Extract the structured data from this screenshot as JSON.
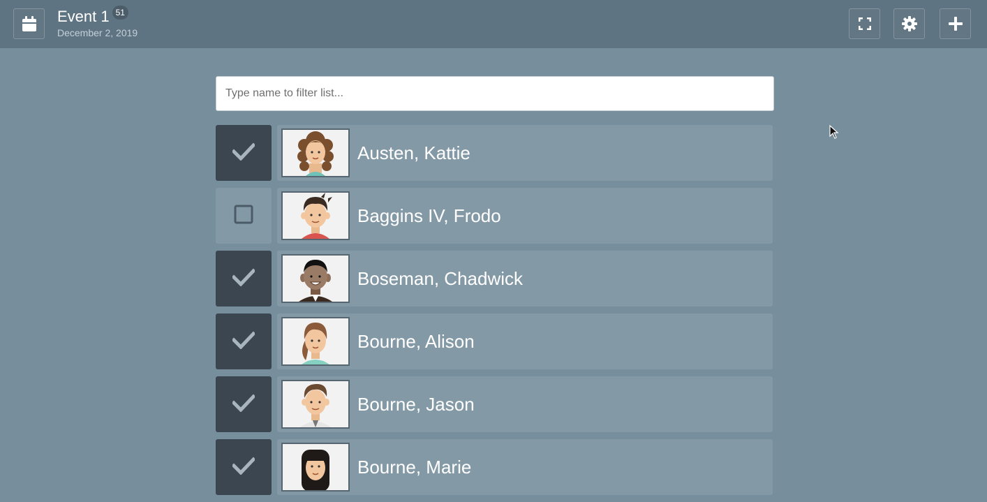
{
  "header": {
    "title": "Event 1",
    "count_badge": "51",
    "date": "December 2, 2019",
    "buttons": {
      "calendar_icon": "calendar-icon",
      "fullscreen_icon": "fullscreen-icon",
      "settings_icon": "gear-icon",
      "add_icon": "plus-icon"
    }
  },
  "filter": {
    "placeholder": "Type name to filter list...",
    "value": ""
  },
  "attendees": [
    {
      "name": "Austen, Kattie",
      "checked": true,
      "avatar": "woman-curly-hair"
    },
    {
      "name": "Baggins IV, Frodo",
      "checked": false,
      "avatar": "boy-dark-hair"
    },
    {
      "name": "Boseman, Chadwick",
      "checked": true,
      "avatar": "man-dark-skin"
    },
    {
      "name": "Bourne, Alison",
      "checked": true,
      "avatar": "woman-ponytail"
    },
    {
      "name": "Bourne, Jason",
      "checked": true,
      "avatar": "man-brown-hair"
    },
    {
      "name": "Bourne, Marie",
      "checked": true,
      "avatar": "woman-bangs"
    }
  ],
  "colors": {
    "background": "#778e9c",
    "header": "#5f7482",
    "card": "#8499a6",
    "checked": "#3b4650"
  }
}
